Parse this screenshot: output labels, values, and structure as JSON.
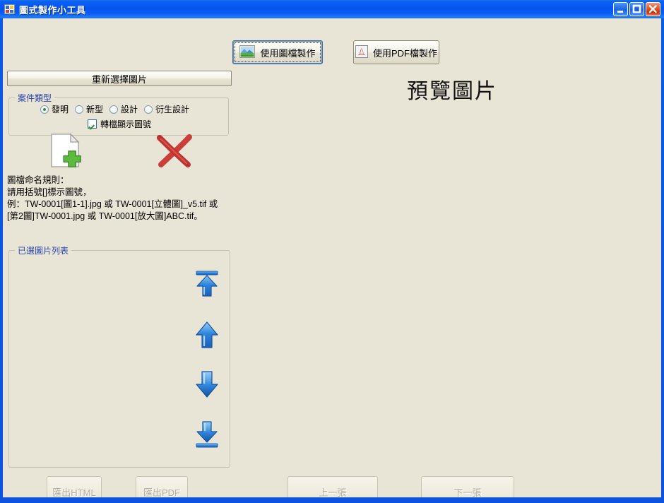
{
  "window": {
    "title": "圖式製作小工具",
    "icon": "app-icon",
    "controls": {
      "minimize": "minimize-icon",
      "maximize": "maximize-icon",
      "close": "close-icon"
    },
    "colors": {
      "titlebar_blue": "#0a5ef5",
      "client_background": "#E9E5D6",
      "group_label_blue": "#2440a8",
      "close_button_red": "#d8400f",
      "disabled_text": "#b3ae9a"
    }
  },
  "toolbar": {
    "make_from_image_label": "使用圖檔製作",
    "make_from_image_icon": "picture-icon",
    "make_from_pdf_label": "使用PDF檔製作",
    "make_from_pdf_icon": "pdf-icon"
  },
  "reselect": {
    "label": "重新選擇圖片"
  },
  "case_type": {
    "group_title": "案件類型",
    "options": [
      {
        "label": "發明",
        "selected": true
      },
      {
        "label": "新型",
        "selected": false
      },
      {
        "label": "設計",
        "selected": false
      },
      {
        "label": "衍生設計",
        "selected": false
      }
    ],
    "checkbox": {
      "label": "轉檔顯示圖號",
      "checked": true
    }
  },
  "actions": {
    "add_file_icon": "add-file-icon",
    "delete_icon": "red-x-delete-icon"
  },
  "naming_rules": {
    "text": "圖檔命名規則：\n請用括號[]標示圖號，\n例：TW-0001[圖1-1].jpg 或 TW-0001[立體圖]_v5.tif 或 [第2圖]TW-0001.jpg 或 TW-0001[放大圖]ABC.tif。"
  },
  "image_list": {
    "group_title": "已選圖片列表",
    "items": [],
    "arrows": [
      {
        "name": "move-to-top",
        "icon": "arrow-to-top-icon"
      },
      {
        "name": "move-up",
        "icon": "arrow-up-icon"
      },
      {
        "name": "move-down",
        "icon": "arrow-down-icon"
      },
      {
        "name": "move-to-bottom",
        "icon": "arrow-to-bottom-icon"
      }
    ]
  },
  "preview": {
    "title": "預覽圖片"
  },
  "footer": {
    "export_html_label": "匯出HTML",
    "export_html_enabled": false,
    "export_pdf_label": "匯出PDF",
    "export_pdf_enabled": false,
    "prev_label": "上一張",
    "prev_enabled": false,
    "next_label": "下一張",
    "next_enabled": false
  }
}
